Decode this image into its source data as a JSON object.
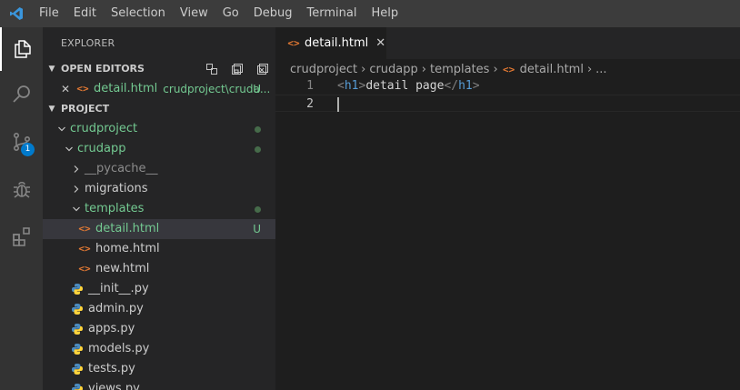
{
  "menu": [
    "File",
    "Edit",
    "Selection",
    "View",
    "Go",
    "Debug",
    "Terminal",
    "Help"
  ],
  "activity": {
    "scm_badge": "1"
  },
  "sidebar": {
    "title": "EXPLORER",
    "open_editors": {
      "header": "OPEN EDITORS",
      "item": {
        "name": "detail.html",
        "path": "crudproject\\cruda...",
        "status": "U"
      }
    },
    "project": {
      "header": "PROJECT",
      "tree": [
        {
          "label": "crudproject",
          "kind": "folder",
          "indent": 0,
          "expanded": true,
          "git": "dot",
          "color": "green"
        },
        {
          "label": "crudapp",
          "kind": "folder",
          "indent": 1,
          "expanded": true,
          "git": "dot",
          "color": "green"
        },
        {
          "label": "__pycache__",
          "kind": "folder",
          "indent": 2,
          "expanded": false,
          "color": "dim"
        },
        {
          "label": "migrations",
          "kind": "folder",
          "indent": 2,
          "expanded": false
        },
        {
          "label": "templates",
          "kind": "folder",
          "indent": 2,
          "expanded": true,
          "git": "dot",
          "color": "green"
        },
        {
          "label": "detail.html",
          "kind": "html",
          "indent": 3,
          "git": "U",
          "color": "green",
          "selected": true
        },
        {
          "label": "home.html",
          "kind": "html",
          "indent": 3
        },
        {
          "label": "new.html",
          "kind": "html",
          "indent": 3
        },
        {
          "label": "__init__.py",
          "kind": "py",
          "indent": 2
        },
        {
          "label": "admin.py",
          "kind": "py",
          "indent": 2
        },
        {
          "label": "apps.py",
          "kind": "py",
          "indent": 2
        },
        {
          "label": "models.py",
          "kind": "py",
          "indent": 2
        },
        {
          "label": "tests.py",
          "kind": "py",
          "indent": 2
        },
        {
          "label": "views.py",
          "kind": "py",
          "indent": 2
        }
      ]
    }
  },
  "editor": {
    "tab": {
      "label": "detail.html",
      "close": "✕"
    },
    "breadcrumbs": [
      "crudproject",
      "crudapp",
      "templates",
      "detail.html",
      "..."
    ],
    "lines": [
      {
        "num": "1",
        "open_tag": "h1",
        "text": "detail page",
        "close_tag": "h1"
      },
      {
        "num": "2"
      }
    ]
  },
  "colors": {
    "accent": "#007acc",
    "git_untracked": "#73c991",
    "html_icon": "#e37933",
    "python_icon": "#4b8bbe"
  }
}
